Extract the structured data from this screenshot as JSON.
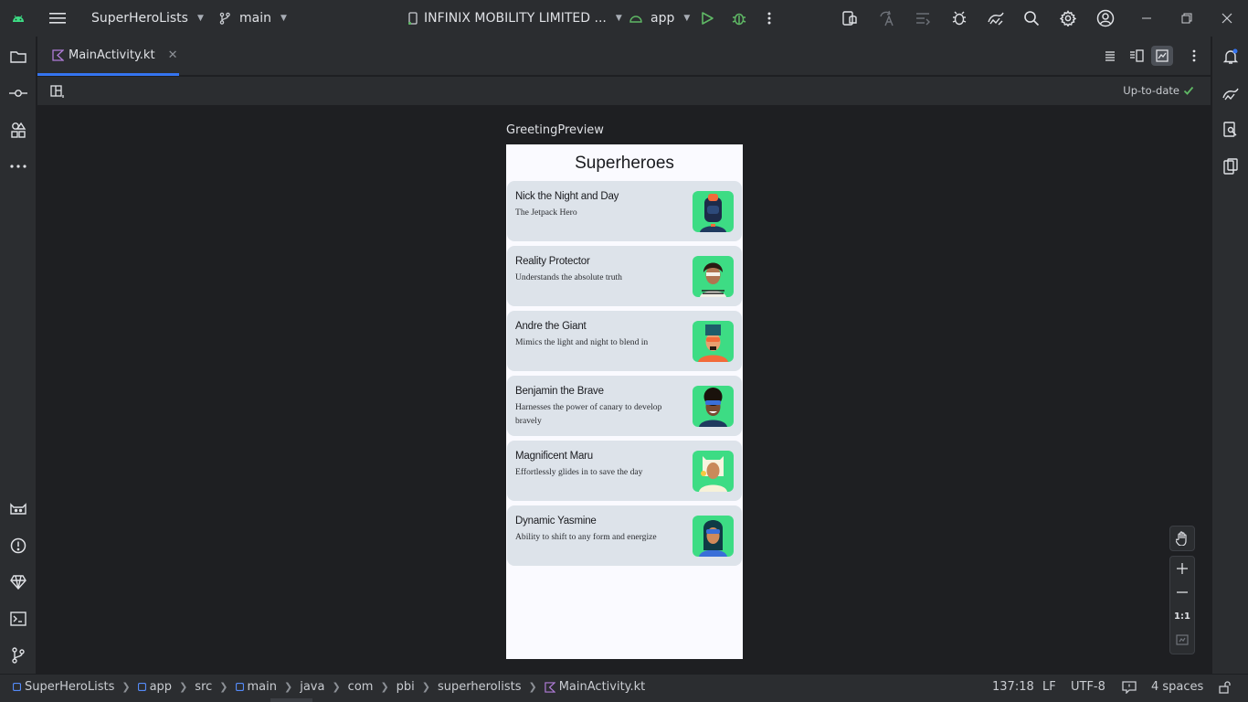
{
  "titlebar": {
    "project": "SuperHeroLists",
    "branch": "main",
    "device": "INFINIX MOBILITY LIMITED ...",
    "run_config": "app"
  },
  "editor": {
    "tab_label": "MainActivity.kt",
    "status": "Up-to-date",
    "preview_label": "GreetingPreview"
  },
  "app": {
    "title": "Superheroes",
    "heroes": [
      {
        "name": "Nick the Night and Day",
        "desc": "The Jetpack Hero"
      },
      {
        "name": "Reality Protector",
        "desc": "Understands the absolute truth"
      },
      {
        "name": "Andre the Giant",
        "desc": "Mimics the light and night to blend in"
      },
      {
        "name": "Benjamin the Brave",
        "desc": "Harnesses the power of canary to develop bravely"
      },
      {
        "name": "Magnificent Maru",
        "desc": "Effortlessly glides in to save the day"
      },
      {
        "name": "Dynamic Yasmine",
        "desc": "Ability to shift to any form and energize"
      }
    ]
  },
  "zoom": {
    "one_to_one": "1:1"
  },
  "statusbar": {
    "breadcrumbs": [
      "SuperHeroLists",
      "app",
      "src",
      "main",
      "java",
      "com",
      "pbi",
      "superherolists",
      "MainActivity.kt"
    ],
    "position": "137:18",
    "line_ending": "LF",
    "encoding": "UTF-8",
    "indent": "4 spaces"
  },
  "colors": {
    "accent": "#3574f0",
    "android_green": "#3ddc84",
    "ok_green": "#5fb865",
    "card_bg": "#dde3ea"
  }
}
